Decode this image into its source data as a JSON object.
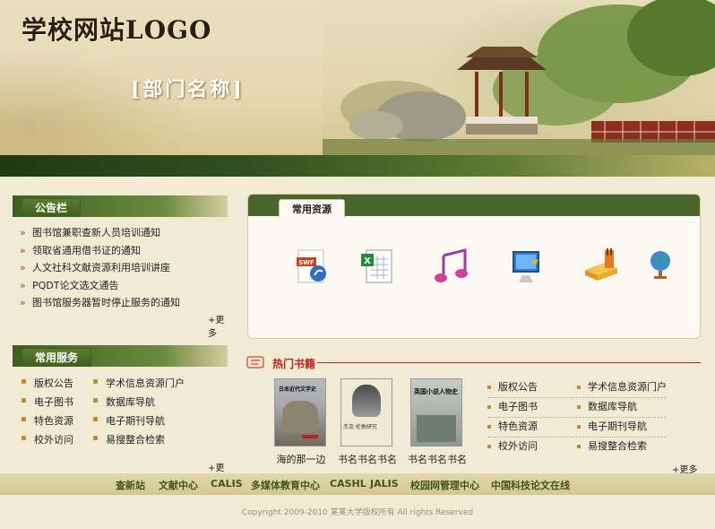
{
  "header": {
    "logo_text": "学校网站LOGO",
    "dept_name": "[部门名称]"
  },
  "notice_panel": {
    "title": "公告栏",
    "items": [
      "图书馆兼职查新人员培训通知",
      "领取省通用借书证的通知",
      "人文社科文献资源利用培训讲座",
      "PQDT论文选文通告",
      "图书馆服务器暂时停止服务的通知"
    ],
    "more": "+更多"
  },
  "service_panel": {
    "title": "常用服务",
    "items": [
      "版权公告",
      "学术信息资源门户",
      "电子图书",
      "数据库导航",
      "特色资源",
      "电子期刊导航",
      "校外访问",
      "易搜整合检索"
    ],
    "more": "+更多"
  },
  "resources_panel": {
    "title": "常用资源",
    "icons": [
      "swf-file-icon",
      "excel-file-icon",
      "music-icon",
      "computer-icon",
      "books-icon",
      "globe-icon"
    ],
    "icon_labels": {
      "swf": "SWF"
    }
  },
  "hot_books": {
    "title": "热门书籍",
    "books": [
      {
        "title": "海的那一边",
        "cover_text": "日本近代文学史"
      },
      {
        "title": "书名书名书名",
        "cover_text": "杰克·伦敦研究"
      },
      {
        "title": "书名书名书名",
        "cover_text": "英国小说人物史"
      }
    ],
    "links": [
      "版权公告",
      "学术信息资源门户",
      "电子图书",
      "数据库导航",
      "特色资源",
      "电子期刊导航",
      "校外访问",
      "易搜整合检索"
    ],
    "more": "+更多"
  },
  "footer": {
    "nav": [
      "查新站",
      "文献中心",
      "CALIS",
      "多媒体教育中心",
      "CASHL",
      "JALIS",
      "校园网管理中心",
      "中国科技论文在线"
    ],
    "copyright": "Copyright 2009-2010 某某大学版权所有 All rights Reserved"
  },
  "colors": {
    "accent_green": "#4e6d2b",
    "hot_red": "#b5261a",
    "background": "#f1ebd6"
  }
}
